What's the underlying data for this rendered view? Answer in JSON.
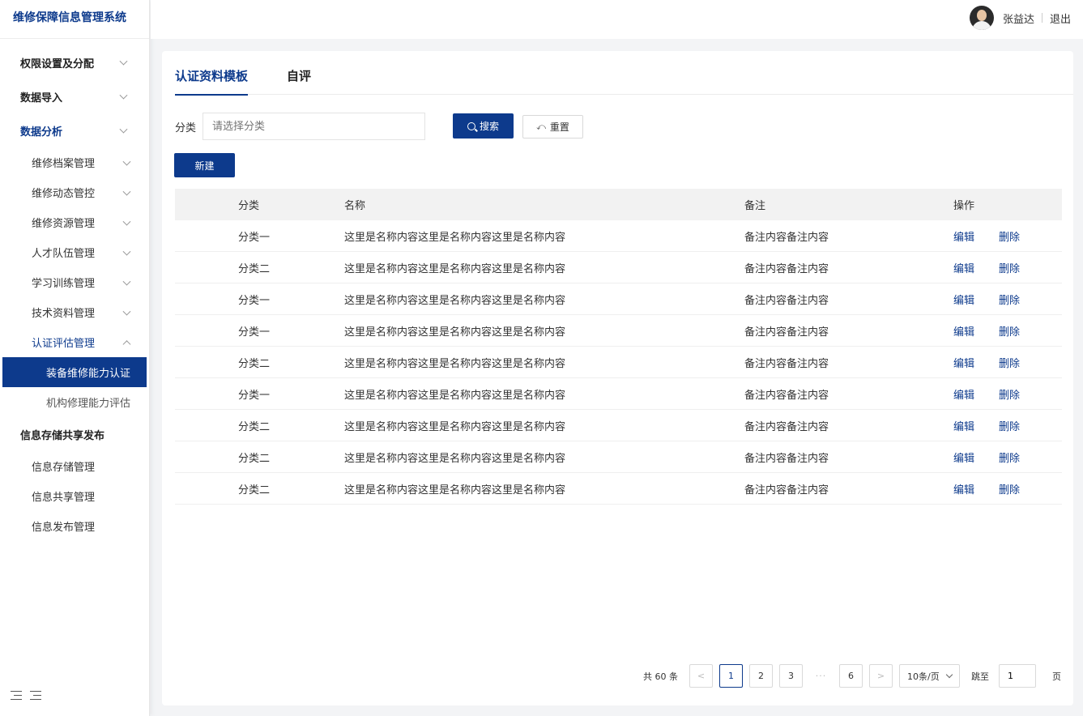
{
  "app": {
    "title": "维修保障信息管理系统"
  },
  "header": {
    "user_name": "张益达",
    "logout": "退出"
  },
  "sidebar": {
    "items": [
      {
        "label": "权限设置及分配"
      },
      {
        "label": "数据导入"
      },
      {
        "label": "数据分析"
      },
      {
        "label": "维修档案管理"
      },
      {
        "label": "维修动态管控"
      },
      {
        "label": "维修资源管理"
      },
      {
        "label": "人才队伍管理"
      },
      {
        "label": "学习训练管理"
      },
      {
        "label": "技术资料管理"
      },
      {
        "label": "认证评估管理"
      },
      {
        "label": "装备维修能力认证"
      },
      {
        "label": "机构修理能力评估"
      },
      {
        "label": "信息存储共享发布"
      },
      {
        "label": "信息存储管理"
      },
      {
        "label": "信息共享管理"
      },
      {
        "label": "信息发布管理"
      }
    ]
  },
  "tabs": [
    {
      "label": "认证资料模板"
    },
    {
      "label": "自评"
    }
  ],
  "filter": {
    "label": "分类",
    "placeholder": "请选择分类",
    "search": "搜索",
    "reset": "重置",
    "new": "新建"
  },
  "table": {
    "headers": {
      "category": "分类",
      "name": "名称",
      "note": "备注",
      "ops": "操作"
    },
    "edit": "编辑",
    "delete": "删除",
    "rows": [
      {
        "category": "分类一",
        "name": "这里是名称内容这里是名称内容这里是名称内容",
        "note": "备注内容备注内容"
      },
      {
        "category": "分类二",
        "name": "这里是名称内容这里是名称内容这里是名称内容",
        "note": "备注内容备注内容"
      },
      {
        "category": "分类一",
        "name": "这里是名称内容这里是名称内容这里是名称内容",
        "note": "备注内容备注内容"
      },
      {
        "category": "分类一",
        "name": "这里是名称内容这里是名称内容这里是名称内容",
        "note": "备注内容备注内容"
      },
      {
        "category": "分类二",
        "name": "这里是名称内容这里是名称内容这里是名称内容",
        "note": "备注内容备注内容"
      },
      {
        "category": "分类一",
        "name": "这里是名称内容这里是名称内容这里是名称内容",
        "note": "备注内容备注内容"
      },
      {
        "category": "分类二",
        "name": "这里是名称内容这里是名称内容这里是名称内容",
        "note": "备注内容备注内容"
      },
      {
        "category": "分类二",
        "name": "这里是名称内容这里是名称内容这里是名称内容",
        "note": "备注内容备注内容"
      },
      {
        "category": "分类二",
        "name": "这里是名称内容这里是名称内容这里是名称内容",
        "note": "备注内容备注内容"
      }
    ]
  },
  "pagination": {
    "total": "共 60 条",
    "pages": [
      "1",
      "2",
      "3",
      "6"
    ],
    "ellipsis": "···",
    "current": "1",
    "page_size": "10条/页",
    "jump_label": "跳至",
    "jump_value": "1",
    "page_unit": "页"
  },
  "colors": {
    "primary": "#0d3a8c"
  }
}
